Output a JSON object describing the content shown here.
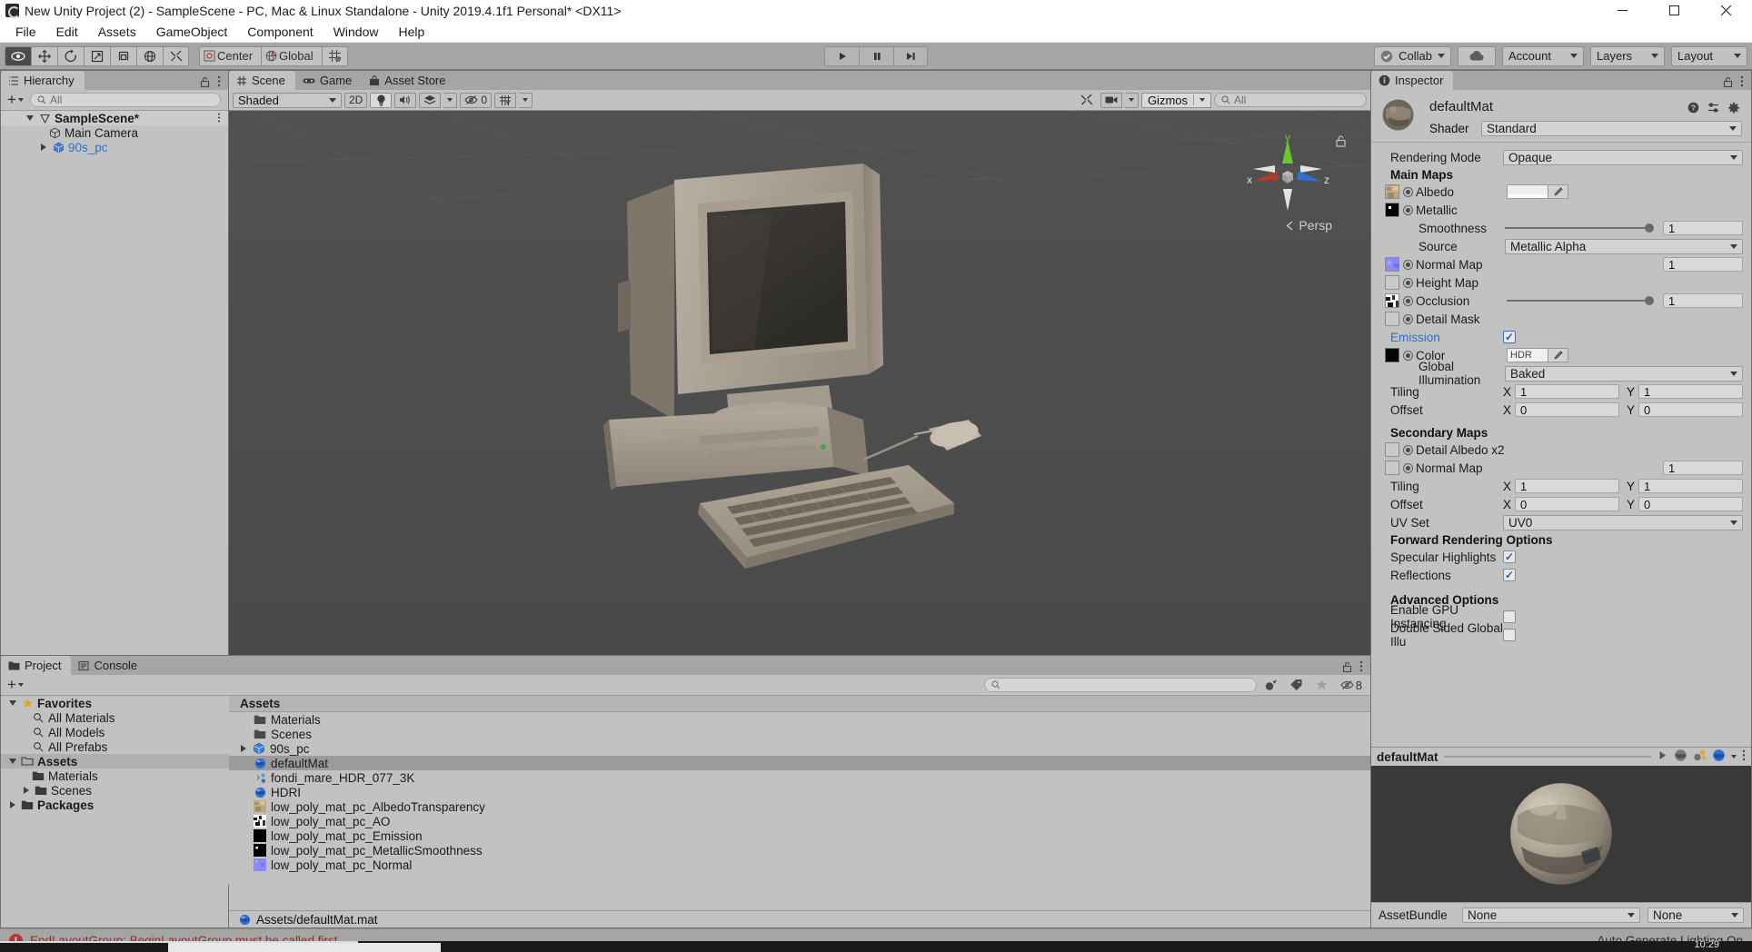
{
  "window": {
    "title": "New Unity Project (2) - SampleScene - PC, Mac & Linux Standalone - Unity 2019.4.1f1 Personal* <DX11>",
    "minimize": "minimize-icon",
    "maximize": "maximize-icon",
    "close": "close-icon"
  },
  "menu": {
    "items": [
      {
        "label": "File"
      },
      {
        "label": "Edit"
      },
      {
        "label": "Assets"
      },
      {
        "label": "GameObject"
      },
      {
        "label": "Component"
      },
      {
        "label": "Window"
      },
      {
        "label": "Help"
      }
    ]
  },
  "toolbar": {
    "tools": [
      {
        "name": "hand-tool",
        "icon": "hand-icon",
        "active": true
      },
      {
        "name": "move-tool",
        "icon": "move-icon",
        "active": false
      },
      {
        "name": "rotate-tool",
        "icon": "rotate-icon",
        "active": false
      },
      {
        "name": "scale-tool",
        "icon": "scale-icon",
        "active": false
      },
      {
        "name": "rect-tool",
        "icon": "rect-icon",
        "active": false
      },
      {
        "name": "transform-tool",
        "icon": "transform-icon",
        "active": false
      },
      {
        "name": "custom-editor-tool",
        "icon": "wrench-icon",
        "active": false
      }
    ],
    "pivot_label": "Center",
    "space_label": "Global",
    "grid_snap_label": "grid-snap-icon",
    "play_label": "play-icon",
    "pause_label": "pause-icon",
    "step_label": "step-icon",
    "collab_label": "Collab",
    "cloud_label": "cloud-icon",
    "account_label": "Account",
    "layers_label": "Layers",
    "layout_label": "Layout"
  },
  "hierarchy": {
    "tab_label": "Hierarchy",
    "search_placeholder": "All",
    "create_label": "+",
    "rows": [
      {
        "label": "SampleScene*",
        "icon": "scene-icon",
        "depth": 0,
        "expanded": true,
        "selected": true,
        "bold": true,
        "blue": false,
        "menu": "⋮"
      },
      {
        "label": "Main Camera",
        "icon": "gameobject-icon",
        "depth": 1,
        "expanded": null,
        "selected": false,
        "bold": false,
        "blue": false
      },
      {
        "label": "90s_pc",
        "icon": "prefab-icon",
        "depth": 1,
        "expanded": false,
        "selected": false,
        "bold": false,
        "blue": true
      }
    ]
  },
  "scene": {
    "tabs": [
      {
        "label": "Scene",
        "icon": "scene-grid-icon",
        "selected": true
      },
      {
        "label": "Game",
        "icon": "gamepad-icon",
        "selected": false
      },
      {
        "label": "Asset Store",
        "icon": "store-icon",
        "selected": false
      }
    ],
    "draw_mode": "Shaded",
    "two_d_label": "2D",
    "lighting_icon": "light-bulb-icon",
    "audio_icon": "speaker-icon",
    "fx_icon": "effects-icon",
    "hidden_count": "0",
    "hidden_icon": "eye-off-icon",
    "grid_icon": "grid-visibility-icon",
    "tools_icon": "scene-tools-icon",
    "camera_icon": "scene-camera-icon",
    "gizmos_label": "Gizmos",
    "search_placeholder": "All",
    "gizmo": {
      "x_label": "x",
      "y_label": "y",
      "z_label": "z",
      "projection_label": "Persp",
      "x_color": "#b03a2e",
      "y_color": "#6ec728",
      "z_color": "#2f6fd0"
    }
  },
  "project": {
    "tabs": [
      {
        "label": "Project",
        "icon": "folder-icon",
        "selected": true
      },
      {
        "label": "Console",
        "icon": "console-icon",
        "selected": false
      }
    ],
    "create_label": "+",
    "search_placeholder": "",
    "hidden_count": "8",
    "tree": [
      {
        "label": "Favorites",
        "icon": "star-icon",
        "depth": 0,
        "expanded": true,
        "bold": true
      },
      {
        "label": "All Materials",
        "icon": "search-icon",
        "depth": 1,
        "expanded": null,
        "bold": false
      },
      {
        "label": "All Models",
        "icon": "search-icon",
        "depth": 1,
        "expanded": null,
        "bold": false
      },
      {
        "label": "All Prefabs",
        "icon": "search-icon",
        "depth": 1,
        "expanded": null,
        "bold": false
      },
      {
        "label": "Assets",
        "icon": "folder-open-icon",
        "depth": 0,
        "expanded": true,
        "bold": true,
        "selected": true
      },
      {
        "label": "Materials",
        "icon": "folder-icon",
        "depth": 1,
        "expanded": null,
        "bold": false
      },
      {
        "label": "Scenes",
        "icon": "folder-icon",
        "depth": 1,
        "expanded": false,
        "bold": false
      },
      {
        "label": "Packages",
        "icon": "folder-icon",
        "depth": 0,
        "expanded": false,
        "bold": true
      }
    ],
    "column_header": "Assets",
    "assets": [
      {
        "label": "Materials",
        "icon": "folder-icon",
        "expandable": false,
        "selected": false
      },
      {
        "label": "Scenes",
        "icon": "folder-icon",
        "expandable": false,
        "selected": false
      },
      {
        "label": "90s_pc",
        "icon": "model-icon",
        "expandable": true,
        "selected": false
      },
      {
        "label": "defaultMat",
        "icon": "material-icon",
        "expandable": false,
        "selected": true
      },
      {
        "label": "fondi_mare_HDR_077_3K",
        "icon": "hdr-icon",
        "expandable": false,
        "selected": false
      },
      {
        "label": "HDRI",
        "icon": "material-icon",
        "expandable": false,
        "selected": false
      },
      {
        "label": "low_poly_mat_pc_AlbedoTransparency",
        "icon": "texture-albedo-icon",
        "expandable": false,
        "selected": false
      },
      {
        "label": "low_poly_mat_pc_AO",
        "icon": "texture-ao-icon",
        "expandable": false,
        "selected": false
      },
      {
        "label": "low_poly_mat_pc_Emission",
        "icon": "texture-black-icon",
        "expandable": false,
        "selected": false
      },
      {
        "label": "low_poly_mat_pc_MetallicSmoothness",
        "icon": "texture-metallic-icon",
        "expandable": false,
        "selected": false
      },
      {
        "label": "low_poly_mat_pc_Normal",
        "icon": "texture-normal-icon",
        "expandable": false,
        "selected": false
      }
    ],
    "breadcrumb": "Assets/defaultMat.mat",
    "breadcrumb_icon": "material-icon"
  },
  "inspector": {
    "tab_label": "Inspector",
    "material_name": "defaultMat",
    "shader_label": "Shader",
    "shader_value": "Standard",
    "help_icon": "help-icon",
    "preset_icon": "preset-icon",
    "settings_icon": "gear-icon",
    "rendering_mode_label": "Rendering Mode",
    "rendering_mode_value": "Opaque",
    "main_maps_label": "Main Maps",
    "albedo_label": "Albedo",
    "metallic_label": "Metallic",
    "smoothness_label": "Smoothness",
    "smoothness_value": "1",
    "source_label": "Source",
    "source_value": "Metallic Alpha",
    "normal_map_label": "Normal Map",
    "normal_map_value": "1",
    "height_map_label": "Height Map",
    "occlusion_label": "Occlusion",
    "occlusion_value": "1",
    "detail_mask_label": "Detail Mask",
    "emission_label": "Emission",
    "emission_checked": true,
    "color_label": "Color",
    "color_hdr_label": "HDR",
    "emission_color": "#050505",
    "global_illumination_label": "Global Illumination",
    "global_illumination_value": "Baked",
    "tiling_label": "Tiling",
    "tiling_x_label": "X",
    "tiling_x": "1",
    "tiling_y_label": "Y",
    "tiling_y": "1",
    "offset_label": "Offset",
    "offset_x_label": "X",
    "offset_x": "0",
    "offset_y_label": "Y",
    "offset_y": "0",
    "secondary_maps_label": "Secondary Maps",
    "detail_albedo_label": "Detail Albedo x2",
    "sec_normal_map_label": "Normal Map",
    "sec_normal_map_value": "1",
    "sec_tiling_label": "Tiling",
    "sec_tiling_x": "1",
    "sec_tiling_y": "1",
    "sec_offset_label": "Offset",
    "sec_offset_x": "0",
    "sec_offset_y": "0",
    "uv_set_label": "UV Set",
    "uv_set_value": "UV0",
    "forward_rendering_label": "Forward Rendering Options",
    "specular_highlights_label": "Specular Highlights",
    "specular_highlights_checked": true,
    "reflections_label": "Reflections",
    "reflections_checked": true,
    "advanced_options_label": "Advanced Options",
    "gpu_instancing_label": "Enable GPU Instancing",
    "gpu_instancing_checked": false,
    "double_sided_gi_label": "Double Sided Global Illu",
    "double_sided_gi_checked": false,
    "preview_title": "defaultMat",
    "preview_play_icon": "play-icon",
    "preview_sphere_icon": "sphere-icon",
    "preview_lighting_icon": "lighting-icon",
    "preview_shape_icon": "shape-icon",
    "preview_menu_icon": "kebab-icon",
    "assetbundle_label": "AssetBundle",
    "assetbundle_value": "None",
    "assetbundle_variant": "None"
  },
  "status": {
    "error_icon": "error-icon",
    "message": "EndLayoutGroup: BeginLayoutGroup must be called first.",
    "lighting": "Auto Generate Lighting On",
    "clock": "10:29"
  }
}
